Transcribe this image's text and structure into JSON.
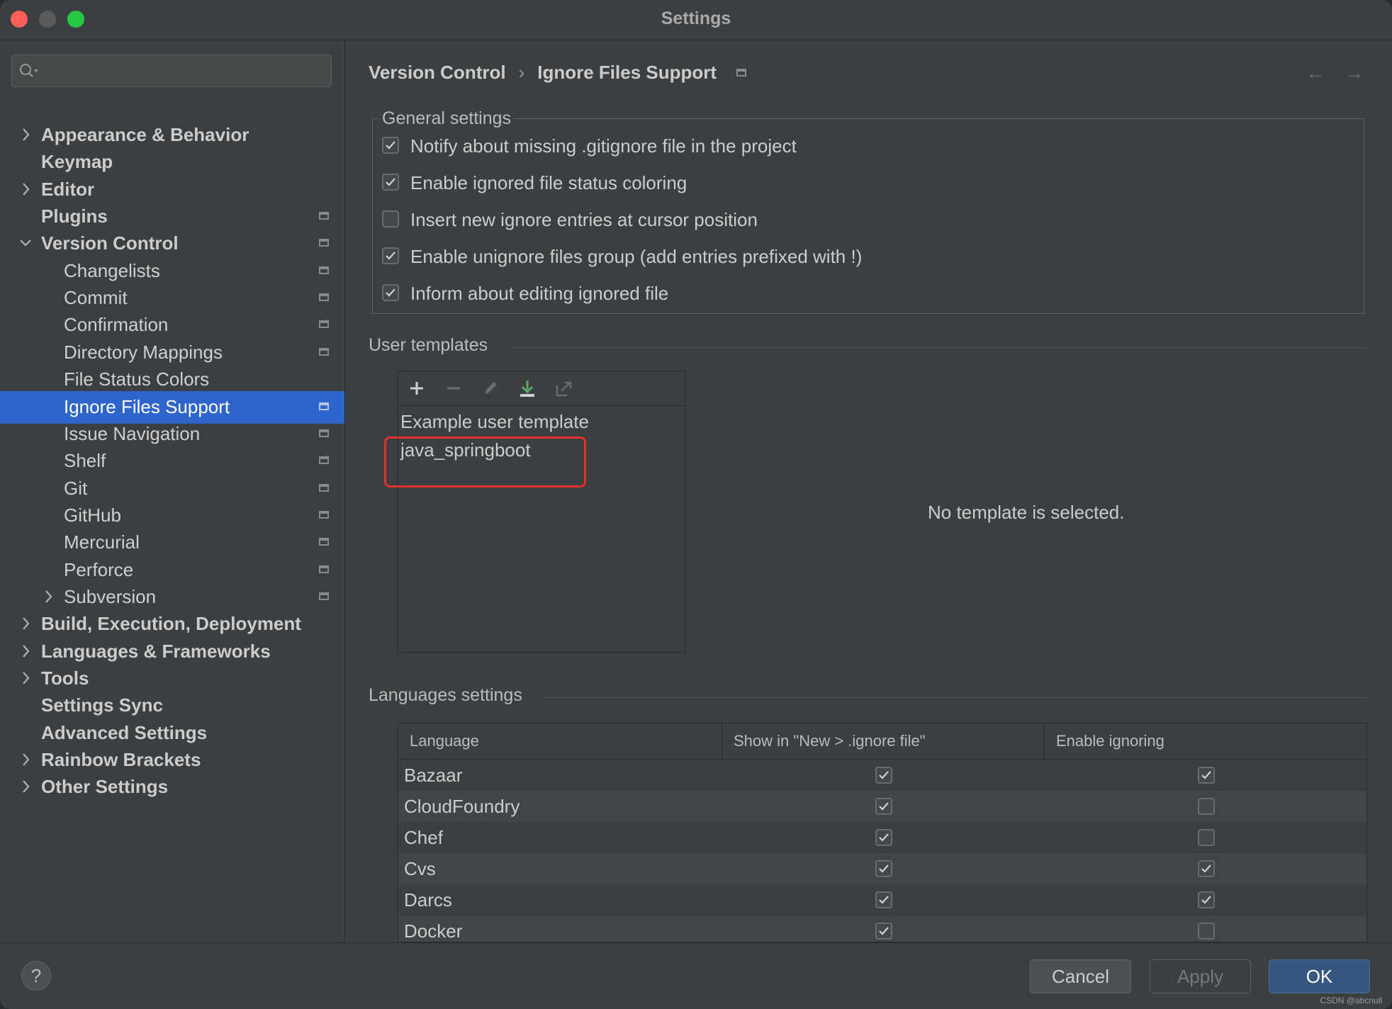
{
  "window": {
    "title": "Settings"
  },
  "sidebar": {
    "search_placeholder": "",
    "items": [
      {
        "label": "Appearance & Behavior",
        "level": 0,
        "bold": true,
        "expand": "collapsed",
        "pinned": false,
        "selected": false
      },
      {
        "label": "Keymap",
        "level": 0,
        "bold": true,
        "expand": "none",
        "pinned": false,
        "selected": false
      },
      {
        "label": "Editor",
        "level": 0,
        "bold": true,
        "expand": "collapsed",
        "pinned": false,
        "selected": false
      },
      {
        "label": "Plugins",
        "level": 0,
        "bold": true,
        "expand": "none",
        "pinned": true,
        "selected": false
      },
      {
        "label": "Version Control",
        "level": 0,
        "bold": true,
        "expand": "expanded",
        "pinned": true,
        "selected": false
      },
      {
        "label": "Changelists",
        "level": 1,
        "bold": false,
        "expand": "none",
        "pinned": true,
        "selected": false
      },
      {
        "label": "Commit",
        "level": 1,
        "bold": false,
        "expand": "none",
        "pinned": true,
        "selected": false
      },
      {
        "label": "Confirmation",
        "level": 1,
        "bold": false,
        "expand": "none",
        "pinned": true,
        "selected": false
      },
      {
        "label": "Directory Mappings",
        "level": 1,
        "bold": false,
        "expand": "none",
        "pinned": true,
        "selected": false
      },
      {
        "label": "File Status Colors",
        "level": 1,
        "bold": false,
        "expand": "none",
        "pinned": false,
        "selected": false
      },
      {
        "label": "Ignore Files Support",
        "level": 1,
        "bold": false,
        "expand": "none",
        "pinned": true,
        "selected": true
      },
      {
        "label": "Issue Navigation",
        "level": 1,
        "bold": false,
        "expand": "none",
        "pinned": true,
        "selected": false
      },
      {
        "label": "Shelf",
        "level": 1,
        "bold": false,
        "expand": "none",
        "pinned": true,
        "selected": false
      },
      {
        "label": "Git",
        "level": 1,
        "bold": false,
        "expand": "none",
        "pinned": true,
        "selected": false
      },
      {
        "label": "GitHub",
        "level": 1,
        "bold": false,
        "expand": "none",
        "pinned": true,
        "selected": false
      },
      {
        "label": "Mercurial",
        "level": 1,
        "bold": false,
        "expand": "none",
        "pinned": true,
        "selected": false
      },
      {
        "label": "Perforce",
        "level": 1,
        "bold": false,
        "expand": "none",
        "pinned": true,
        "selected": false
      },
      {
        "label": "Subversion",
        "level": 1,
        "bold": false,
        "expand": "collapsed",
        "pinned": true,
        "selected": false
      },
      {
        "label": "Build, Execution, Deployment",
        "level": 0,
        "bold": true,
        "expand": "collapsed",
        "pinned": false,
        "selected": false
      },
      {
        "label": "Languages & Frameworks",
        "level": 0,
        "bold": true,
        "expand": "collapsed",
        "pinned": false,
        "selected": false
      },
      {
        "label": "Tools",
        "level": 0,
        "bold": true,
        "expand": "collapsed",
        "pinned": false,
        "selected": false
      },
      {
        "label": "Settings Sync",
        "level": 0,
        "bold": true,
        "expand": "none",
        "pinned": false,
        "selected": false
      },
      {
        "label": "Advanced Settings",
        "level": 0,
        "bold": true,
        "expand": "none",
        "pinned": false,
        "selected": false
      },
      {
        "label": "Rainbow Brackets",
        "level": 0,
        "bold": true,
        "expand": "collapsed",
        "pinned": false,
        "selected": false
      },
      {
        "label": "Other Settings",
        "level": 0,
        "bold": true,
        "expand": "collapsed",
        "pinned": false,
        "selected": false
      }
    ]
  },
  "breadcrumb": {
    "parent": "Version Control",
    "separator": "›",
    "current": "Ignore Files Support"
  },
  "nav": {
    "back": "←",
    "forward": "→"
  },
  "general": {
    "title": "General settings",
    "options": [
      {
        "label": "Notify about missing .gitignore file in the project",
        "checked": true
      },
      {
        "label": "Enable ignored file status coloring",
        "checked": true
      },
      {
        "label": "Insert new ignore entries at cursor position",
        "checked": false
      },
      {
        "label": "Enable unignore files group (add entries prefixed with !)",
        "checked": true
      },
      {
        "label": "Inform about editing ignored file",
        "checked": true
      }
    ]
  },
  "user_templates": {
    "title": "User templates",
    "toolbar": [
      "add-icon",
      "remove-icon",
      "edit-icon",
      "import-icon",
      "export-icon"
    ],
    "items": [
      "Example user template",
      "java_springboot"
    ],
    "empty_message": "No template is selected.",
    "highlight_color": "#e0302a"
  },
  "languages": {
    "title": "Languages settings",
    "headers": [
      "Language",
      "Show in \"New > .ignore file\"",
      "Enable ignoring"
    ],
    "rows": [
      {
        "name": "Bazaar",
        "show": true,
        "enable": true
      },
      {
        "name": "CloudFoundry",
        "show": true,
        "enable": false
      },
      {
        "name": "Chef",
        "show": true,
        "enable": false
      },
      {
        "name": "Cvs",
        "show": true,
        "enable": true
      },
      {
        "name": "Darcs",
        "show": true,
        "enable": true
      },
      {
        "name": "Docker",
        "show": true,
        "enable": false
      }
    ]
  },
  "footer": {
    "help": "?",
    "cancel": "Cancel",
    "apply": "Apply",
    "ok": "OK",
    "watermark": "CSDN @abcnull"
  },
  "colors": {
    "selection": "#2f65ca",
    "primary_button": "#365880",
    "accent_download": "#59a869"
  }
}
